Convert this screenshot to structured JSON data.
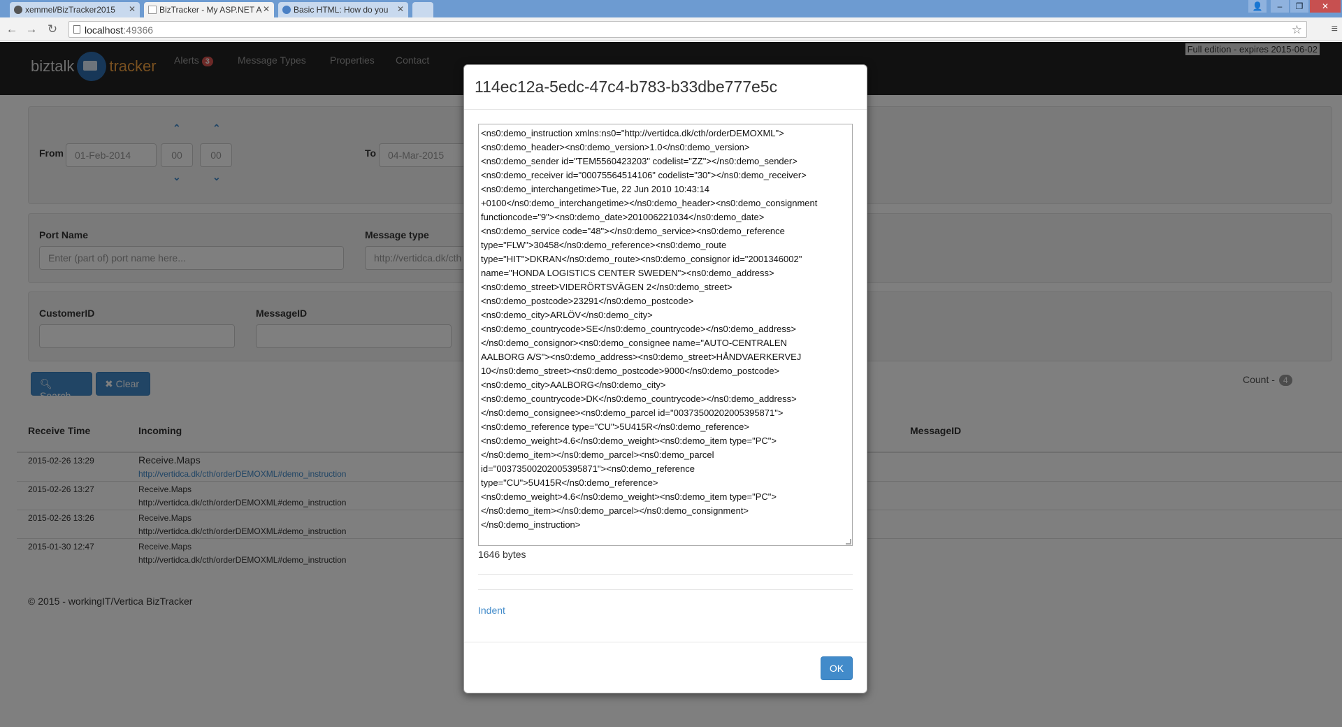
{
  "browser": {
    "tabs": [
      {
        "title": "xemmel/BizTracker2015"
      },
      {
        "title": "BizTracker - My ASP.NET A"
      },
      {
        "title": "Basic HTML: How do you"
      }
    ],
    "url_host": "localhost",
    "url_port": ":49366"
  },
  "navbar": {
    "brand_left": "biztalk",
    "brand_right": "tracker",
    "alerts_label": "Alerts",
    "alerts_count": "3",
    "message_types": "Message Types",
    "properties": "Properties",
    "contact": "Contact",
    "edition": "Full edition - expires 2015-06-02"
  },
  "filters": {
    "from_label": "From",
    "from_date": "01-Feb-2014",
    "from_hour": "00",
    "from_min": "00",
    "to_label": "To",
    "to_date": "04-Mar-2015",
    "port_name_label": "Port Name",
    "port_name_placeholder": "Enter (part of) port name here...",
    "message_type_label": "Message type",
    "message_type_value": "http://vertidca.dk/cth",
    "customer_id_label": "CustomerID",
    "message_id_label": "MessageID",
    "search_button": "Search",
    "clear_button": "Clear",
    "count_label": "Count -",
    "count_value": "4"
  },
  "table": {
    "headers": [
      "Receive Time",
      "Incoming",
      "MessageID"
    ],
    "rows": [
      {
        "time": "2015-02-26 13:29",
        "port": "Receive.Maps",
        "type": "http://vertidca.dk/cth/orderDEMOXML#demo_instruction"
      },
      {
        "time": "2015-02-26 13:27",
        "port": "Receive.Maps",
        "type": "http://vertidca.dk/cth/orderDEMOXML#demo_instruction"
      },
      {
        "time": "2015-02-26 13:26",
        "port": "Receive.Maps",
        "type": "http://vertidca.dk/cth/orderDEMOXML#demo_instruction"
      },
      {
        "time": "2015-01-30 12:47",
        "port": "Receive.Maps",
        "type": "http://vertidca.dk/cth/orderDEMOXML#demo_instruction"
      }
    ]
  },
  "footer": "© 2015 - workingIT/Vertica BizTracker",
  "modal": {
    "title": "114ec12a-5edc-47c4-b783-b33dbe777e5c",
    "xml_lines": [
      "<ns0:demo_instruction xmlns:ns0=\"http://vertidca.dk/cth/orderDEMOXML\">",
      "<ns0:demo_header><ns0:demo_version>1.0</ns0:demo_version>",
      "<ns0:demo_sender id=\"TEM5560423203\" codelist=\"ZZ\"></ns0:demo_sender>",
      "<ns0:demo_receiver id=\"00075564514106\" codelist=\"30\"></ns0:demo_receiver>",
      "<ns0:demo_interchangetime>Tue, 22 Jun 2010 10:43:14",
      "+0100</ns0:demo_interchangetime></ns0:demo_header><ns0:demo_consignment",
      "functioncode=\"9\"><ns0:demo_date>201006221034</ns0:demo_date>",
      "<ns0:demo_service code=\"48\"></ns0:demo_service><ns0:demo_reference",
      "type=\"FLW\">30458</ns0:demo_reference><ns0:demo_route",
      "type=\"HIT\">DKRAN</ns0:demo_route><ns0:demo_consignor id=\"2001346002\"",
      "name=\"HONDA LOGISTICS CENTER SWEDEN\"><ns0:demo_address>",
      "<ns0:demo_street>VIDERÖRTSVÄGEN 2</ns0:demo_street>",
      "<ns0:demo_postcode>23291</ns0:demo_postcode>",
      "<ns0:demo_city>ARLÖV</ns0:demo_city>",
      "<ns0:demo_countrycode>SE</ns0:demo_countrycode></ns0:demo_address>",
      "</ns0:demo_consignor><ns0:demo_consignee name=\"AUTO-CENTRALEN",
      "AALBORG A/S\"><ns0:demo_address><ns0:demo_street>HÅNDVAERKERVEJ",
      "10</ns0:demo_street><ns0:demo_postcode>9000</ns0:demo_postcode>",
      "<ns0:demo_city>AALBORG</ns0:demo_city>",
      "<ns0:demo_countrycode>DK</ns0:demo_countrycode></ns0:demo_address>",
      "</ns0:demo_consignee><ns0:demo_parcel id=\"00373500202005395871\">",
      "<ns0:demo_reference type=\"CU\">5U415R</ns0:demo_reference>",
      "<ns0:demo_weight>4.6</ns0:demo_weight><ns0:demo_item type=\"PC\">",
      "</ns0:demo_item></ns0:demo_parcel><ns0:demo_parcel",
      "id=\"00373500202005395871\"><ns0:demo_reference",
      "type=\"CU\">5U415R</ns0:demo_reference>",
      "<ns0:demo_weight>4.6</ns0:demo_weight><ns0:demo_item type=\"PC\">",
      "</ns0:demo_item></ns0:demo_parcel></ns0:demo_consignment>",
      "</ns0:demo_instruction>"
    ],
    "bytes": "1646 bytes",
    "indent_link": "Indent",
    "ok_button": "OK"
  },
  "colors": {
    "accent": "#428bca",
    "badge": "#d9534f",
    "navbar": "#222222"
  }
}
